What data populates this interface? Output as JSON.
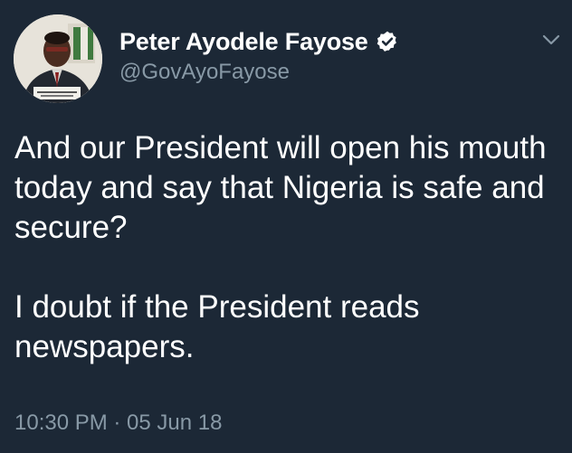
{
  "tweet": {
    "author": {
      "display_name": "Peter Ayodele Fayose",
      "handle": "@GovAyoFayose",
      "verified": true,
      "avatar_icon": "profile-photo"
    },
    "body": [
      "And our President will open his mouth today and say that Nigeria is safe and secure?",
      "I doubt if the President reads newspapers."
    ],
    "timestamp": "10:30 PM · 05 Jun 18",
    "menu_icon": "chevron-down-icon"
  },
  "colors": {
    "background": "#1c2836",
    "primary_text": "#ffffff",
    "secondary_text": "#8899a6",
    "verified_badge": "#ffffff"
  }
}
